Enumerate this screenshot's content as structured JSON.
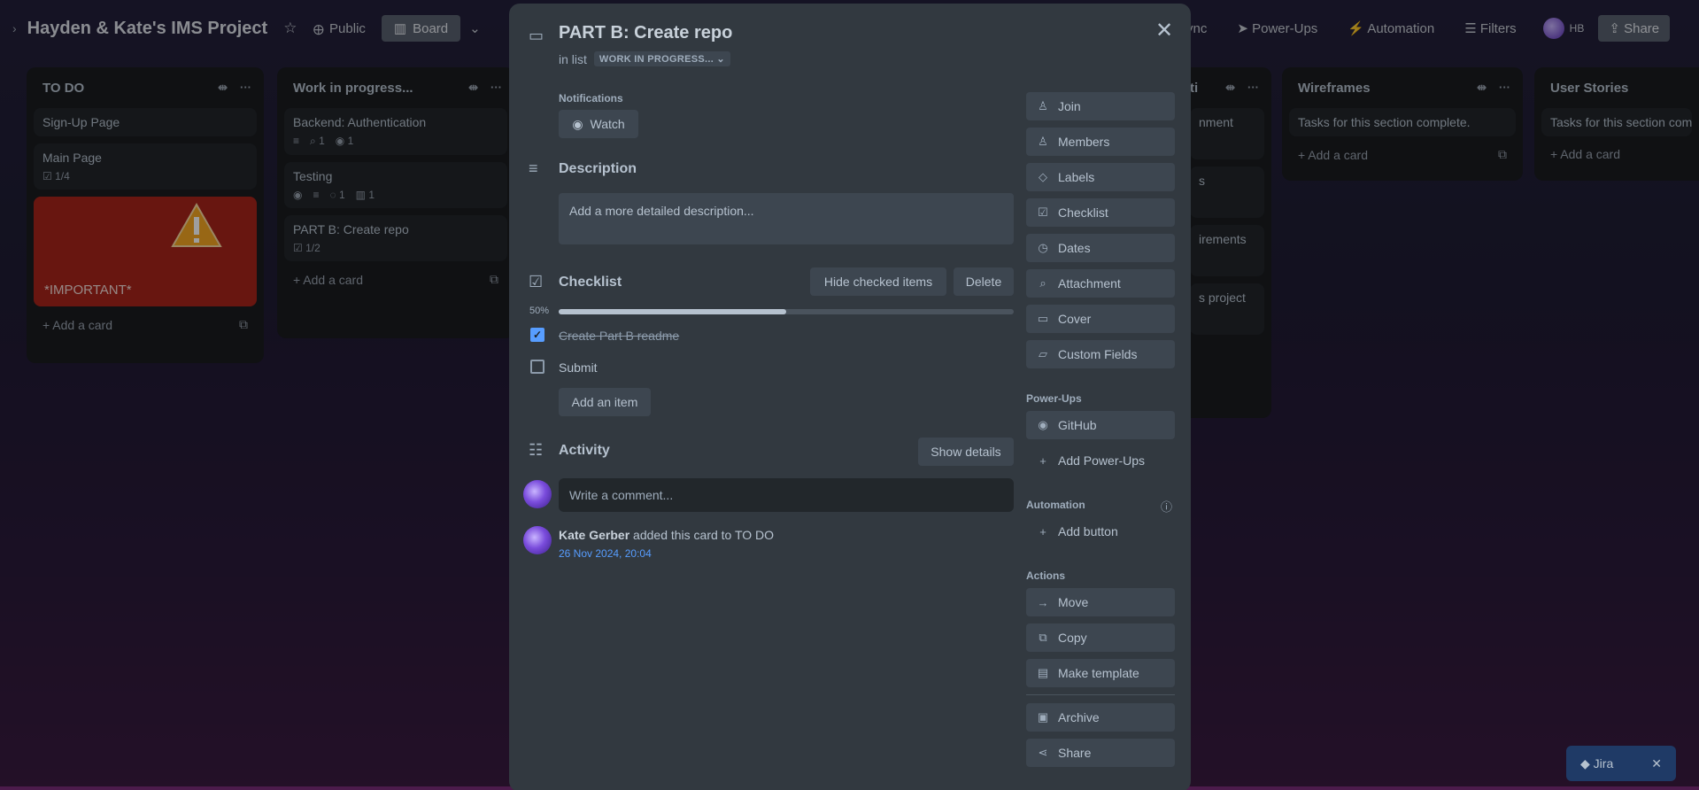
{
  "board": {
    "title": "Hayden & Kate's IMS Project",
    "visibility": "Public",
    "view": "Board",
    "right_items": {
      "sync": "ync",
      "powerups": "Power-Ups",
      "automation": "Automation",
      "filters": "Filters",
      "initials": "HB",
      "share": "Share"
    }
  },
  "lists": [
    {
      "title": "TO DO",
      "cards": [
        {
          "title": "Sign-Up Page"
        },
        {
          "title": "Main Page",
          "checklist": "1/4"
        },
        {
          "title": "*IMPORTANT*"
        }
      ],
      "add": "Add a card"
    },
    {
      "title": "Work in progress...",
      "cards": [
        {
          "title": "Backend: Authentication",
          "attach": "1",
          "github": "1"
        },
        {
          "title": "Testing",
          "comments": "1",
          "trello": "1"
        },
        {
          "title": "PART B: Create repo",
          "checklist": "1/2"
        }
      ],
      "add": "Add a card"
    },
    {
      "title": "Wireframes",
      "cards": [
        {
          "title": "Tasks for this section complete."
        }
      ],
      "add": "Add a card"
    },
    {
      "title": "User Stories",
      "cards": [
        {
          "title": "Tasks for this section com"
        }
      ],
      "add": "Add a card"
    }
  ],
  "partial_list": {
    "title": "ti",
    "cards": [
      "nment",
      "s",
      "irements",
      "s project"
    ]
  },
  "modal": {
    "title": "PART B: Create repo",
    "in_list_label": "in list",
    "list_name": "WORK IN PROGRESS...",
    "notifications_label": "Notifications",
    "watch_label": "Watch",
    "description_title": "Description",
    "description_placeholder": "Add a more detailed description...",
    "checklist_title": "Checklist",
    "hide_checked": "Hide checked items",
    "delete_label": "Delete",
    "progress_label": "50%",
    "progress": 0.5,
    "items": [
      {
        "text": "Create Part B readme",
        "checked": true
      },
      {
        "text": "Submit",
        "checked": false
      }
    ],
    "add_item": "Add an item",
    "activity_title": "Activity",
    "show_details": "Show details",
    "comment_placeholder": "Write a comment...",
    "activity": {
      "user": "Kate Gerber",
      "action": "added this card to TO DO",
      "time": "26 Nov 2024, 20:04"
    },
    "sidebar": {
      "add_to_card": [
        "Join",
        "Members",
        "Labels",
        "Checklist",
        "Dates",
        "Attachment",
        "Cover",
        "Custom Fields"
      ],
      "powerups_label": "Power-Ups",
      "github": "GitHub",
      "add_powerups": "Add Power-Ups",
      "automation_label": "Automation",
      "add_button": "Add button",
      "actions_label": "Actions",
      "actions": [
        "Move",
        "Copy",
        "Make template",
        "Archive",
        "Share"
      ]
    }
  },
  "jira": {
    "label": "Jira"
  },
  "colors": {
    "accent": "#579dff",
    "modal_bg": "#323940",
    "important_card": "#a8241a"
  }
}
